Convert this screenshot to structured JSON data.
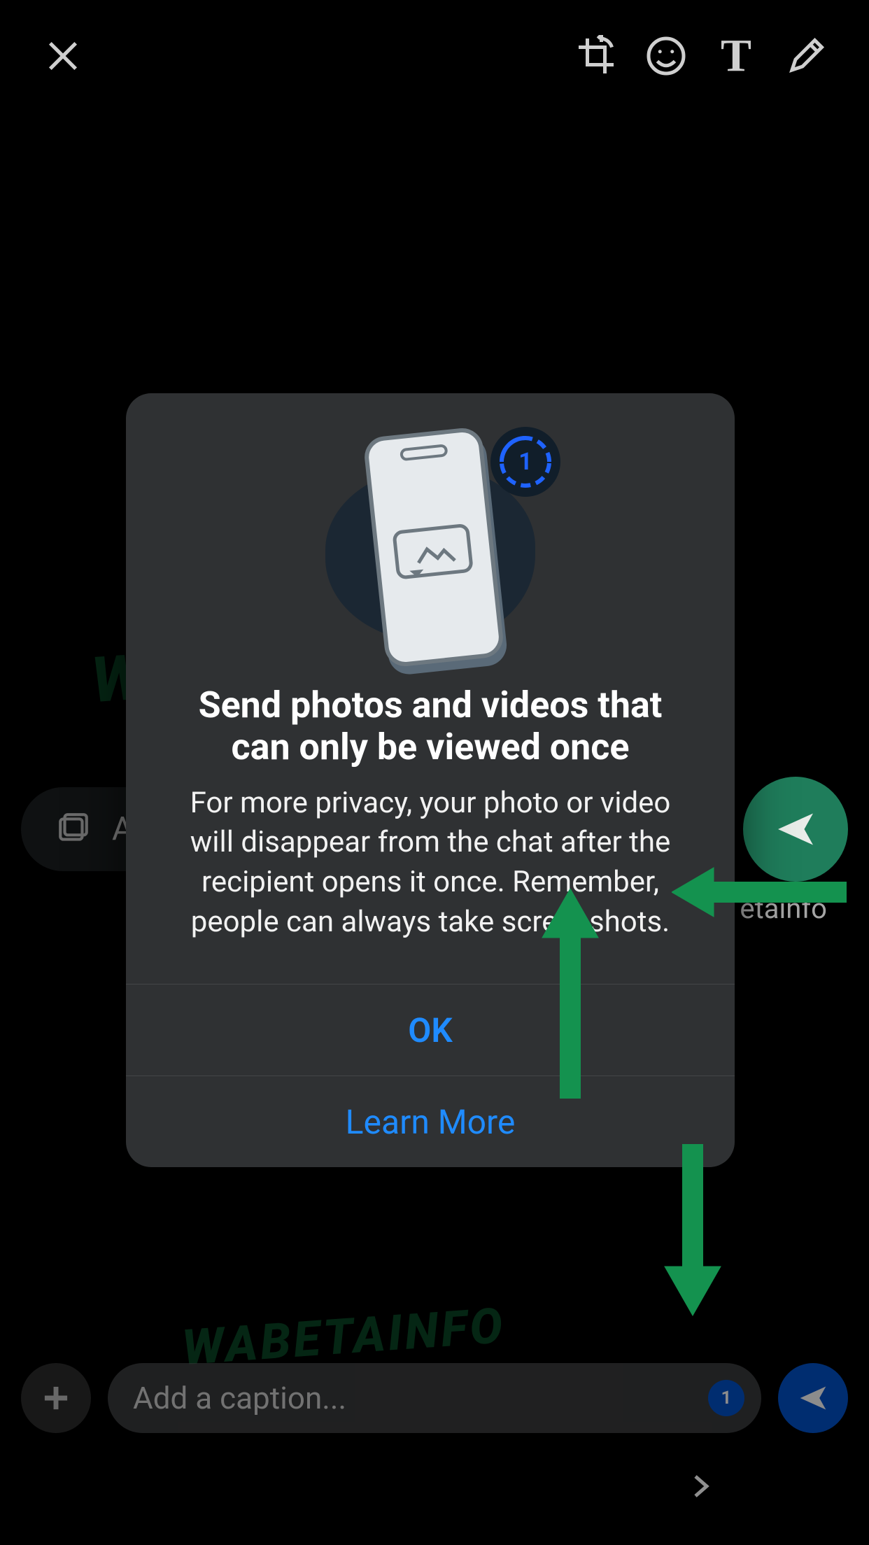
{
  "toolbar": {
    "close": "close",
    "crop": "crop-rotate",
    "emoji": "emoji",
    "text": "T",
    "draw": "pencil"
  },
  "midrow": {
    "caption_hint": "A",
    "beta_label": "etainfo"
  },
  "bottom": {
    "placeholder": "Add a caption...",
    "once_badge": "1"
  },
  "dialog": {
    "once_digit": "1",
    "title": "Send photos and videos that can only be viewed once",
    "body": "For more privacy, your photo or video will disappear from the chat after the recipient opens it once. Remember, people can always take screenshots.",
    "ok_label": "OK",
    "learn_label": "Learn More"
  },
  "watermark": "WABETAINFO"
}
